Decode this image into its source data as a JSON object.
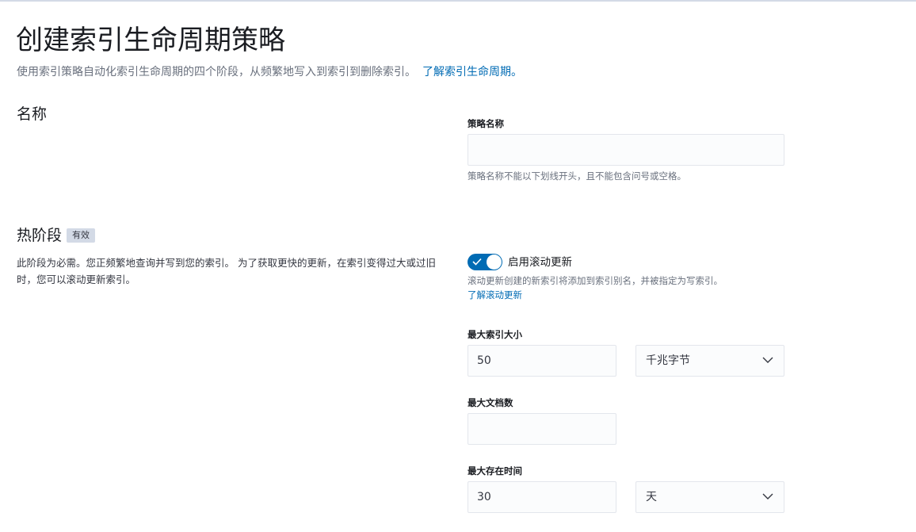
{
  "page": {
    "title": "创建索引生命周期策略",
    "description": "使用索引策略自动化索引生命周期的四个阶段，从频繁地写入到索引到删除索引。",
    "learn_more_link": "了解索引生命周期。"
  },
  "name_section": {
    "title": "名称",
    "field_label": "策略名称",
    "field_value": "",
    "help_text": "策略名称不能以下划线开头，且不能包含问号或空格。"
  },
  "hot_phase": {
    "title": "热阶段",
    "badge": "有效",
    "description": "此阶段为必需。您正频繁地查询并写到您的索引。 为了获取更快的更新，在索引变得过大或过旧时，您可以滚动更新索引。",
    "rollover": {
      "toggle_label": "启用滚动更新",
      "enabled": true,
      "help_text": "滚动更新创建的新索引将添加到索引别名，并被指定为写索引。",
      "learn_link": "了解滚动更新"
    },
    "max_size": {
      "label": "最大索引大小",
      "value": "50",
      "unit": "千兆字节"
    },
    "max_docs": {
      "label": "最大文档数",
      "value": ""
    },
    "max_age": {
      "label": "最大存在时间",
      "value": "30",
      "unit": "天"
    }
  },
  "colors": {
    "primary": "#006bb4",
    "badge_bg": "#d3dae6",
    "input_bg": "#fbfcfd",
    "subdued_text": "#69707d"
  },
  "icons": {
    "toggle_check": "check-icon",
    "select_arrow": "chevron-down-icon"
  }
}
